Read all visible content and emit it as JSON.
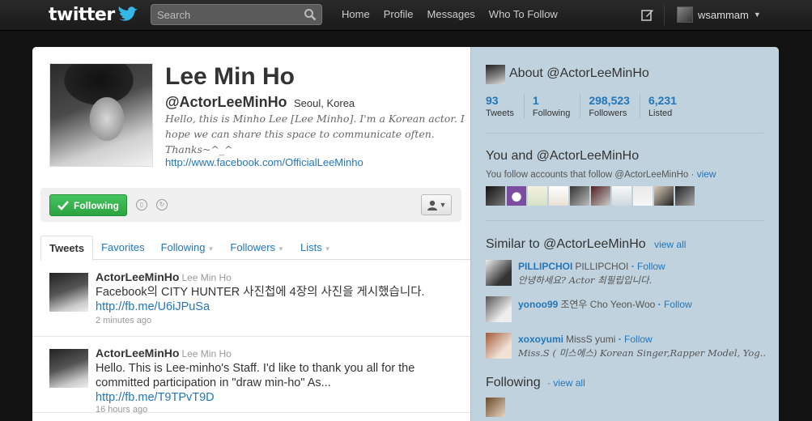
{
  "colors": {
    "accent": "#2276bb",
    "follow_green": "#2ca33f",
    "sidebar_bg": "#c0d2dd"
  },
  "topbar": {
    "logo": "twitter",
    "search_placeholder": "Search",
    "nav": [
      "Home",
      "Profile",
      "Messages",
      "Who To Follow"
    ],
    "username": "wsammam"
  },
  "profile": {
    "name": "Lee Min Ho",
    "handle": "@ActorLeeMinHo",
    "location": "Seoul, Korea",
    "bio": "Hello, this is Minho Lee [Lee Minho]. I'm a Korean actor. I hope we can share this space to communicate often. Thanks~^_^",
    "url": "http://www.facebook.com/OfficialLeeMinho",
    "follow_label": "Following"
  },
  "tabs": [
    {
      "label": "Tweets",
      "dropdown": false
    },
    {
      "label": "Favorites",
      "dropdown": false
    },
    {
      "label": "Following",
      "dropdown": true
    },
    {
      "label": "Followers",
      "dropdown": true
    },
    {
      "label": "Lists",
      "dropdown": true
    }
  ],
  "tweets": [
    {
      "user": "ActorLeeMinHo",
      "name": "Lee Min Ho",
      "text": "Facebook의 CITY HUNTER 사진첩에 4장의 사진을 게시했습니다.",
      "link": "http://fb.me/U6iJPuSa",
      "time": "2 minutes ago"
    },
    {
      "user": "ActorLeeMinHo",
      "name": "Lee Min Ho",
      "text": "Hello. This is Lee-minho's Staff. I'd like to thank you all for the committed participation in \"draw min-ho\" As...",
      "link": "http://fb.me/T9TPvT9D",
      "time": "16 hours ago"
    }
  ],
  "sidebar": {
    "about_title": "About @ActorLeeMinHo",
    "stats": [
      {
        "num": "93",
        "label": "Tweets"
      },
      {
        "num": "1",
        "label": "Following"
      },
      {
        "num": "298,523",
        "label": "Followers"
      },
      {
        "num": "6,231",
        "label": "Listed"
      }
    ],
    "you_and_title": "You and @ActorLeeMinHo",
    "you_follow_text": "You follow accounts that follow @ActorLeeMinHo",
    "view_label": "view",
    "similar_title": "Similar to @ActorLeeMinHo",
    "view_all_label": "view all",
    "similar": [
      {
        "user": "PILLIPCHOI",
        "name": "PILLIPCHOI",
        "follow": "Follow",
        "desc": "안녕하세요? Actor 최필립입니다."
      },
      {
        "user": "yonoo99",
        "name": "조연우 Cho Yeon-Woo",
        "follow": "Follow",
        "desc": ""
      },
      {
        "user": "xoxoyumi",
        "name": "MissS yumi",
        "follow": "Follow",
        "desc": "Miss.S ( 미스에스) Korean Singer,Rapper Model, Yog..."
      }
    ],
    "following_title": "Following",
    "following_view_all": "view all"
  }
}
